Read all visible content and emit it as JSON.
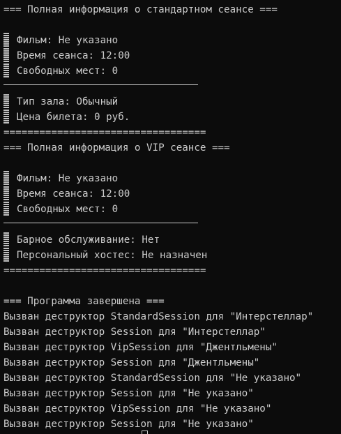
{
  "terminal": {
    "standard": {
      "header": "=== Полная информация о стандартном сеансе ===",
      "film": "Фильм: Не указано",
      "time": "Время сеанса: 12:00",
      "seats": "Свободных мест: 0",
      "hall": "Тип зала: Обычный",
      "price": "Цена билета: 0 руб.",
      "separator": "=================================="
    },
    "vip": {
      "header": "=== Полная информация о VIP сеансе ===",
      "film": "Фильм: Не указано",
      "time": "Время сеанса: 12:00",
      "seats": "Свободных мест: 0",
      "bar_service": "Барное обслуживание: Нет",
      "host": "Персональный хостес: Не назначен",
      "separator": "=================================="
    },
    "program_end": "=== Программа завершена ===",
    "destructors": [
      "Вызван деструктор StandardSession для \"Интерстеллар\"",
      "Вызван деструктор Session для \"Интерстеллар\"",
      "Вызван деструктор VipSession для \"Джентльмены\"",
      "Вызван деструктор Session для \"Джентльмены\"",
      "Вызван деструктор StandardSession для \"Не указано\"",
      "Вызван деструктор Session для \"Не указано\"",
      "Вызван деструктор VipSession для \"Не указано\"",
      "Вызван деструктор Session для \"Не указано\""
    ]
  },
  "colors": {
    "background": "#0c0c0c",
    "text": "#cccccc"
  }
}
